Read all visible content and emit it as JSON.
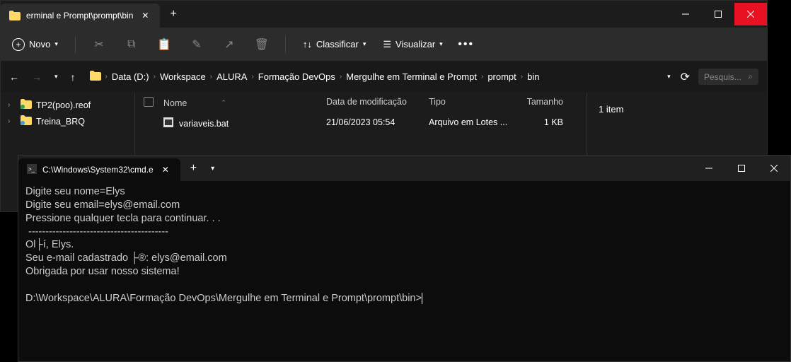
{
  "explorer": {
    "tab_title": "erminal e Prompt\\prompt\\bin",
    "new_label": "Novo",
    "toolbar": {
      "sort": "Classificar",
      "view": "Visualizar"
    },
    "breadcrumbs": [
      "Data (D:)",
      "Workspace",
      "ALURA",
      "Formação DevOps",
      "Mergulhe em Terminal e Prompt",
      "prompt",
      "bin"
    ],
    "search_placeholder": "Pesquis...",
    "tree": [
      {
        "name": "TP2(poo).reof"
      },
      {
        "name": "Treina_BRQ"
      }
    ],
    "headers": {
      "name": "Nome",
      "date": "Data de modificação",
      "type": "Tipo",
      "size": "Tamanho"
    },
    "files": [
      {
        "name": "variaveis.bat",
        "date": "21/06/2023 05:54",
        "type": "Arquivo em Lotes ...",
        "size": "1 KB"
      }
    ],
    "details": "1 item"
  },
  "terminal": {
    "tab_title": "C:\\Windows\\System32\\cmd.e",
    "lines": [
      "Digite seu nome=Elys",
      "Digite seu email=elys@email.com",
      "Pressione qualquer tecla para continuar. . .",
      " -----------------------------------------",
      "Ol├í, Elys.",
      "Seu e-mail cadastrado ├®: elys@email.com",
      "Obrigada por usar nosso sistema!",
      "",
      "D:\\Workspace\\ALURA\\Formação DevOps\\Mergulhe em Terminal e Prompt\\prompt\\bin>"
    ]
  }
}
